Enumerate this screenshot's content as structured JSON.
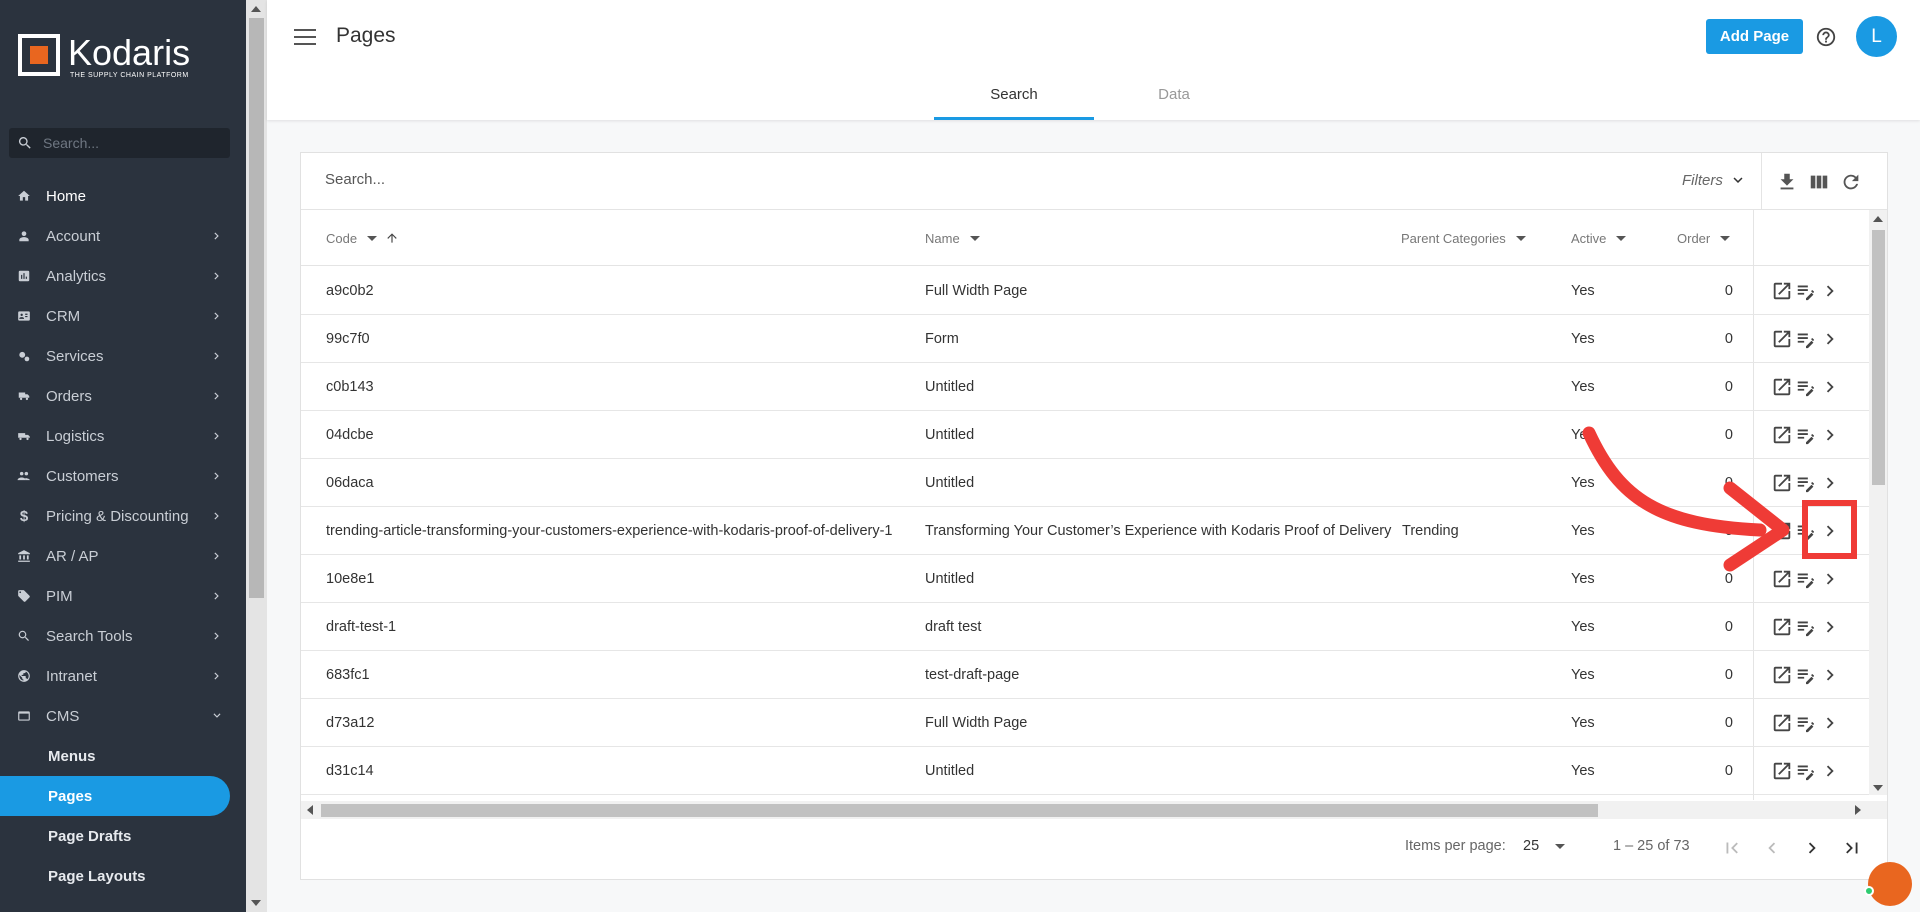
{
  "brand": {
    "name": "Kodaris",
    "tagline": "THE SUPPLY CHAIN PLATFORM"
  },
  "sidebar": {
    "search_placeholder": "Search...",
    "items": [
      {
        "label": "Home",
        "icon": "home-icon",
        "chevron": false
      },
      {
        "label": "Account",
        "icon": "person-icon",
        "chevron": true
      },
      {
        "label": "Analytics",
        "icon": "analytics-icon",
        "chevron": true
      },
      {
        "label": "CRM",
        "icon": "contact-card-icon",
        "chevron": true
      },
      {
        "label": "Services",
        "icon": "gears-icon",
        "chevron": true
      },
      {
        "label": "Orders",
        "icon": "truck-icon",
        "chevron": true
      },
      {
        "label": "Logistics",
        "icon": "delivery-icon",
        "chevron": true
      },
      {
        "label": "Customers",
        "icon": "people-icon",
        "chevron": true
      },
      {
        "label": "Pricing & Discounting",
        "icon": "dollar-icon",
        "chevron": true
      },
      {
        "label": "AR / AP",
        "icon": "bank-icon",
        "chevron": true
      },
      {
        "label": "PIM",
        "icon": "tag-icon",
        "chevron": true
      },
      {
        "label": "Search Tools",
        "icon": "search-icon",
        "chevron": true
      },
      {
        "label": "Intranet",
        "icon": "globe-icon",
        "chevron": true
      },
      {
        "label": "CMS",
        "icon": "cms-icon",
        "chevron": "down"
      }
    ],
    "cms_children": [
      {
        "label": "Menus",
        "active": false
      },
      {
        "label": "Pages",
        "active": true
      },
      {
        "label": "Page Drafts",
        "active": false
      },
      {
        "label": "Page Layouts",
        "active": false
      }
    ]
  },
  "header": {
    "title": "Pages",
    "add_button": "Add Page",
    "avatar_initial": "L",
    "tabs": [
      {
        "label": "Search",
        "active": true
      },
      {
        "label": "Data",
        "active": false
      }
    ]
  },
  "table": {
    "search_placeholder": "Search...",
    "filters_label": "Filters",
    "columns": {
      "code": "Code",
      "name": "Name",
      "parent": "Parent Categories",
      "active": "Active",
      "order": "Order"
    },
    "rows": [
      {
        "code": "a9c0b2",
        "name": "Full Width Page",
        "parent": "",
        "active": "Yes",
        "order": "0"
      },
      {
        "code": "99c7f0",
        "name": "Form",
        "parent": "",
        "active": "Yes",
        "order": "0"
      },
      {
        "code": "c0b143",
        "name": "Untitled",
        "parent": "",
        "active": "Yes",
        "order": "0"
      },
      {
        "code": "04dcbe",
        "name": "Untitled",
        "parent": "",
        "active": "Yes",
        "order": "0"
      },
      {
        "code": "06daca",
        "name": "Untitled",
        "parent": "",
        "active": "Yes",
        "order": "0"
      },
      {
        "code": "trending-article-transforming-your-customers-experience-with-kodaris-proof-of-delivery-1",
        "name": "Transforming Your Customer’s Experience with Kodaris Proof of Delivery",
        "parent": "Trending",
        "active": "Yes",
        "order": "0"
      },
      {
        "code": "10e8e1",
        "name": "Untitled",
        "parent": "",
        "active": "Yes",
        "order": "0"
      },
      {
        "code": "draft-test-1",
        "name": "draft test",
        "parent": "",
        "active": "Yes",
        "order": "0"
      },
      {
        "code": "683fc1",
        "name": "test-draft-page",
        "parent": "",
        "active": "Yes",
        "order": "0"
      },
      {
        "code": "d73a12",
        "name": "Full Width Page",
        "parent": "",
        "active": "Yes",
        "order": "0"
      },
      {
        "code": "d31c14",
        "name": "Untitled",
        "parent": "",
        "active": "Yes",
        "order": "0"
      }
    ],
    "pager": {
      "items_per_page_label": "Items per page:",
      "items_per_page": "25",
      "range": "1 – 25 of 73"
    }
  },
  "colors": {
    "accent": "#1a9ae3",
    "sidebar_bg": "#2b333e",
    "annotation": "#ef3b36",
    "brand_orange": "#e9661f"
  }
}
